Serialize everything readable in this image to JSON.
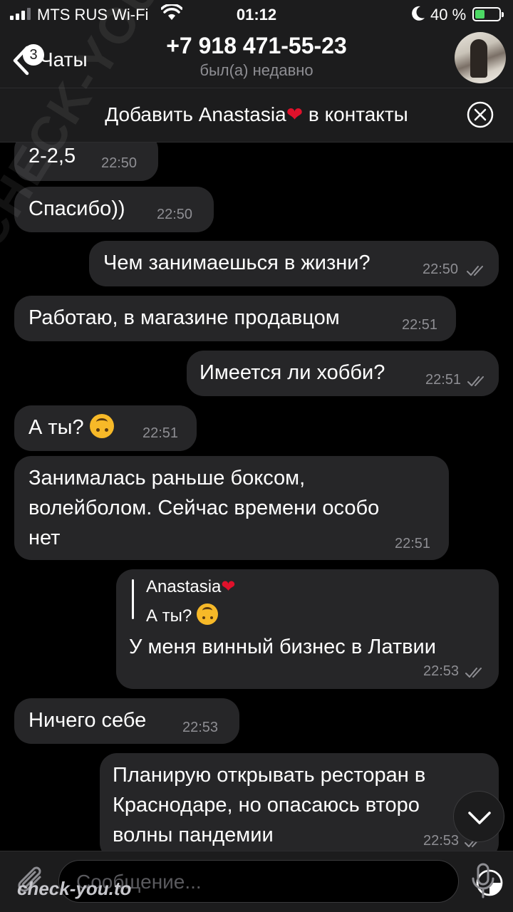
{
  "status_bar": {
    "carrier": "MTS RUS Wi-Fi",
    "time": "01:12",
    "battery_percent": "40 %",
    "battery_level": 0.4,
    "icons": [
      "signal-icon",
      "wifi-icon",
      "moon-icon",
      "battery-icon"
    ]
  },
  "header": {
    "back_label": "Чаты",
    "unread_badge": "3",
    "title": "+7 918 471-55-23",
    "subtitle": "был(а) недавно"
  },
  "add_contact": {
    "label_before": "Добавить Anastasia",
    "label_after": " в контакты"
  },
  "messages": [
    {
      "direction": "in",
      "text": "2-2,5",
      "time": "22:50"
    },
    {
      "direction": "in",
      "text": "Спасибо))",
      "time": "22:50"
    },
    {
      "direction": "out",
      "text": "Чем занимаешься в жизни?",
      "time": "22:50",
      "read": true
    },
    {
      "direction": "in",
      "text": "Работаю, в магазине продавцом",
      "time": "22:51"
    },
    {
      "direction": "out",
      "text": "Имеется ли хобби?",
      "time": "22:51",
      "read": true
    },
    {
      "direction": "in",
      "text": "А ты?",
      "time": "22:51",
      "emoji": "upside-down-face"
    },
    {
      "direction": "in",
      "lines": [
        "Занималась раньше боксом,",
        "волейболом. Сейчас времени особо",
        "нет"
      ],
      "time": "22:51"
    },
    {
      "direction": "out",
      "reply_to": {
        "author": "Anastasia",
        "text": "А ты?"
      },
      "text": "У меня винный бизнес в Латвии",
      "time": "22:53",
      "read": true
    },
    {
      "direction": "in",
      "text": "Ничего себе",
      "time": "22:53"
    },
    {
      "direction": "out",
      "lines": [
        "Планирую открывать ресторан в",
        "Краснодаре, но опасаюсь второ",
        "волны пандемии"
      ],
      "time": "22:53",
      "read": true
    }
  ],
  "input": {
    "placeholder": "Сообщение..."
  },
  "watermark": {
    "diagonal": "CHECK-YOU.ME",
    "bottom": "check-you.to"
  },
  "colors": {
    "background": "#000000",
    "bar": "#1c1c1d",
    "bubble": "#262628",
    "secondary_text": "#8e8e93",
    "battery_fill": "#4cd964",
    "heart": "#e0112b"
  }
}
